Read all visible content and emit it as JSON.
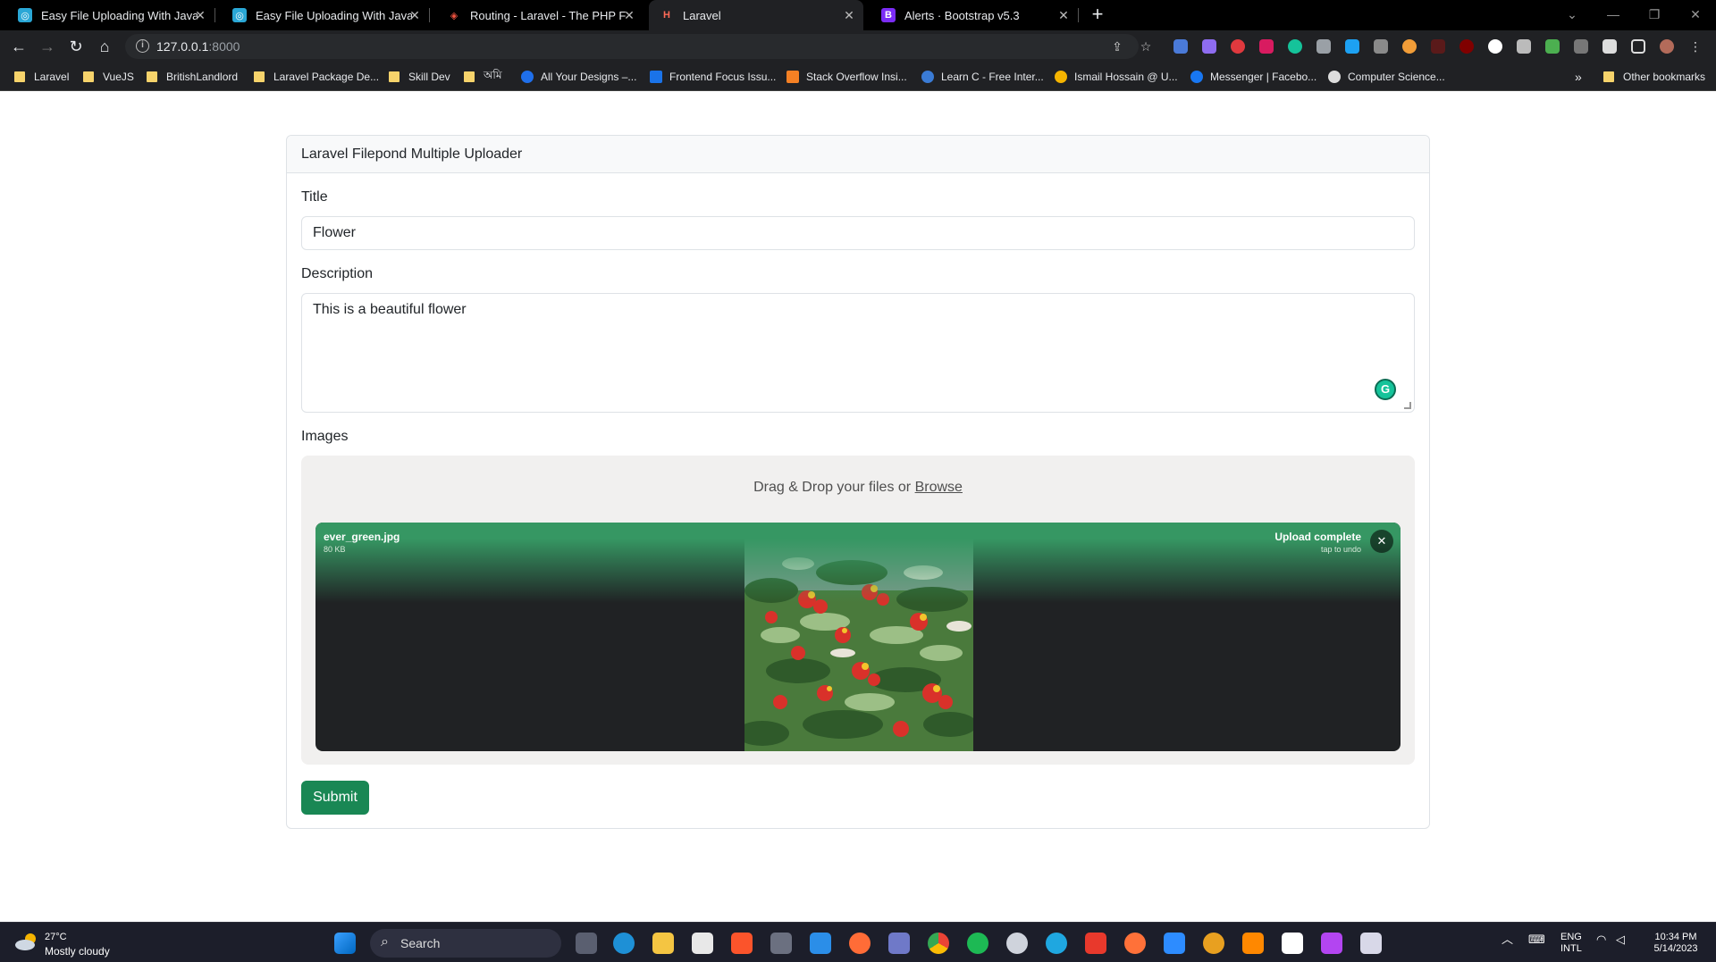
{
  "browser": {
    "tabs": [
      {
        "title": "Easy File Uploading With JavaScr",
        "favicon_color": "#2aa7d6",
        "active": false
      },
      {
        "title": "Easy File Uploading With JavaScr",
        "favicon_color": "#2aa7d6",
        "active": false
      },
      {
        "title": "Routing - Laravel - The PHP Fram",
        "favicon_color": "#f05340",
        "active": false
      },
      {
        "title": "Laravel",
        "favicon_color": "#ff6b57",
        "active": true
      },
      {
        "title": "Alerts · Bootstrap v5.3",
        "favicon_color": "#7b2cf5",
        "active": false
      }
    ],
    "new_tab_label": "+",
    "address": {
      "host": "127.0.0.1",
      "port": ":8000"
    },
    "bookmarks": [
      {
        "label": "Laravel",
        "kind": "folder"
      },
      {
        "label": "VueJS",
        "kind": "folder"
      },
      {
        "label": "BritishLandlord",
        "kind": "folder"
      },
      {
        "label": "Laravel Package De...",
        "kind": "folder"
      },
      {
        "label": "Skill Dev",
        "kind": "folder"
      },
      {
        "label": "অমি",
        "kind": "folder"
      },
      {
        "label": "All Your Designs –...",
        "kind": "site",
        "color": "#1f6feb"
      },
      {
        "label": "Frontend Focus Issu...",
        "kind": "site",
        "color": "#1a73e8"
      },
      {
        "label": "Stack Overflow Insi...",
        "kind": "site",
        "color": "#f48024"
      },
      {
        "label": "Learn C - Free Inter...",
        "kind": "site",
        "color": "#3a7bd5"
      },
      {
        "label": "Ismail Hossain @ U...",
        "kind": "site",
        "color": "#f5b400"
      },
      {
        "label": "Messenger | Facebo...",
        "kind": "site",
        "color": "#1877f2"
      },
      {
        "label": "Computer Science...",
        "kind": "site",
        "color": "#dddddd"
      }
    ],
    "bookmarks_overflow": "»",
    "other_bookmarks": "Other bookmarks"
  },
  "form": {
    "card_title": "Laravel Filepond Multiple Uploader",
    "title_label": "Title",
    "title_value": "Flower",
    "description_label": "Description",
    "description_value": "This is a beautiful flower",
    "images_label": "Images",
    "drop_text": "Drag & Drop your files or ",
    "browse_label": "Browse",
    "file": {
      "name": "ever_green.jpg",
      "size": "80 KB",
      "status": "Upload complete",
      "status_sub": "tap to undo"
    },
    "submit_label": "Submit"
  },
  "taskbar": {
    "temperature": "27°C",
    "weather": "Mostly cloudy",
    "search_label": "Search",
    "language_top": "ENG",
    "language_bottom": "INTL",
    "time": "10:34 PM",
    "date": "5/14/2023"
  },
  "colors": {
    "primary_button": "#198754",
    "filepond_success": "#369763",
    "filepond_panel": "#f1f0ef"
  }
}
